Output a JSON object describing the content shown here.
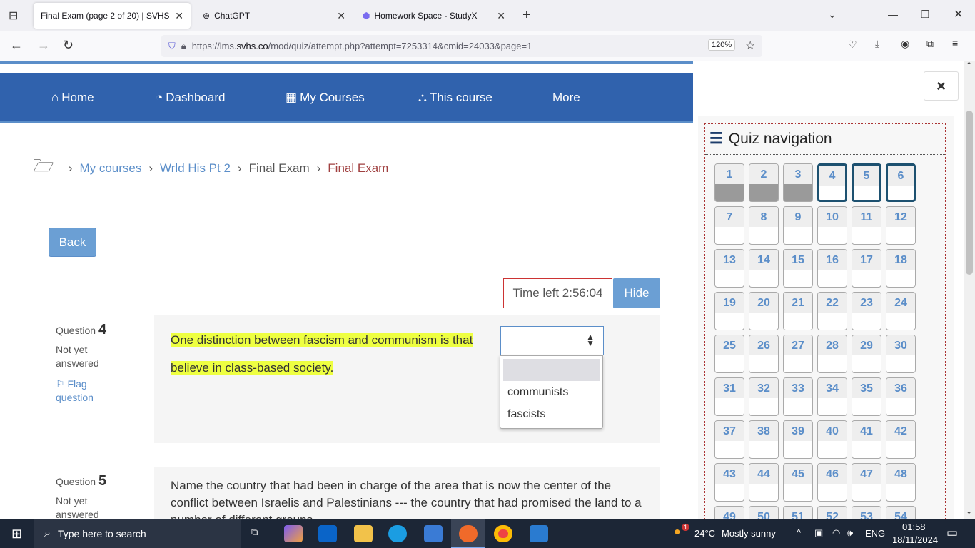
{
  "browser": {
    "tabs": [
      {
        "title": "Final Exam (page 2 of 20) | SVHS",
        "active": true
      },
      {
        "title": "ChatGPT"
      },
      {
        "title": "Homework Space - StudyX"
      }
    ],
    "url_prefix": "https://lms.",
    "url_domain": "svhs.co",
    "url_path": "/mod/quiz/attempt.php?attempt=7253314&cmid=24033&page=1",
    "zoom": "120%"
  },
  "mainnav": {
    "items": [
      "Home",
      "Dashboard",
      "My Courses",
      "This course",
      "More"
    ]
  },
  "breadcrumb": [
    "My courses",
    "Wrld His Pt 2",
    "Final Exam",
    "Final Exam"
  ],
  "back_label": "Back",
  "timer": {
    "text": "Time left 2:56:04",
    "hide_label": "Hide"
  },
  "questions": [
    {
      "label": "Question",
      "number": "4",
      "status": "Not yet answered",
      "flag": "Flag question",
      "text_before": "One distinction between fascism and communism is that",
      "text_after": "believe in class-based society.",
      "options": [
        "",
        "communists",
        "fascists"
      ]
    },
    {
      "label": "Question",
      "number": "5",
      "status": "Not yet answered",
      "text": "Name the country that had been in charge of the area that is now the center of the conflict between Israelis and Palestinians --- the country that had promised the land to a number of different groups."
    }
  ],
  "quiz_nav": {
    "title": "Quiz navigation",
    "close": "×",
    "count": 54,
    "answered": [
      1,
      2,
      3
    ],
    "current_page": [
      4,
      5,
      6
    ]
  },
  "taskbar": {
    "search": "Type here to search",
    "weather_temp": "24°C",
    "weather_text": "Mostly sunny",
    "weather_badge": "1",
    "lang": "ENG",
    "time": "01:58",
    "date": "18/11/2024"
  }
}
